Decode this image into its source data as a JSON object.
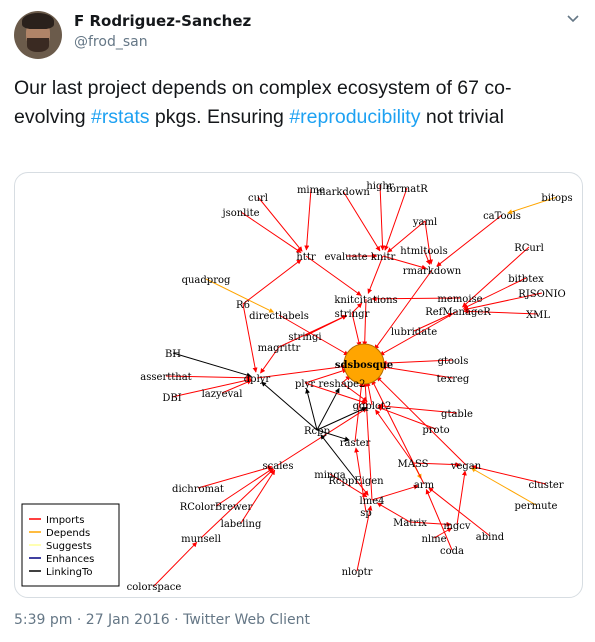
{
  "author": {
    "name": "F Rodriguez-Sanchez",
    "handle": "@frod_san"
  },
  "tweet": {
    "t1": "Our last project depends on complex ecosystem of 67 co-evolving ",
    "h1": "#rstats",
    "t2": " pkgs. Ensuring ",
    "h2": "#reproducibility",
    "t3": " not trivial"
  },
  "graph": {
    "center": "sdsbosque",
    "packages": [
      "mime",
      "markdown",
      "highr",
      "formatR",
      "curl",
      "jsonlite",
      "bitops",
      "caTools",
      "yaml",
      "httr",
      "evaluate",
      "knitr",
      "htmltools",
      "rmarkdown",
      "RCurl",
      "bitbtex",
      "RJSONIO",
      "XML",
      "quadprog",
      "R6",
      "knitcitations",
      "memoise",
      "RefManageR",
      "directlabels",
      "stringr",
      "lubridate",
      "stringi",
      "magrittr",
      "gtools",
      "texreg",
      "BH",
      "assertthat",
      "dplyr",
      "plyr",
      "reshape2",
      "DBI",
      "lazyeval",
      "ggplot2",
      "gtable",
      "proto",
      "Rcpp",
      "raster",
      "MASS",
      "vegan",
      "scales",
      "cluster",
      "dichromat",
      "minqa",
      "RcppEigen",
      "arm",
      "RColorBrewer",
      "lme4",
      "permute",
      "sp",
      "labeling",
      "Matrix",
      "mgcv",
      "munsell",
      "nlme",
      "abind",
      "coda",
      "colorspace",
      "nloptr"
    ],
    "legend": [
      "Imports",
      "Depends",
      "Suggests",
      "Enhances",
      "LinkingTo"
    ],
    "legend_colors": [
      "#ff0000",
      "#ffa500",
      "#ffff99",
      "#000080",
      "#000000"
    ]
  },
  "meta": {
    "time": "5:39 pm",
    "sep": " · ",
    "date": "27 Jan 2016",
    "client": "Twitter Web Client"
  }
}
